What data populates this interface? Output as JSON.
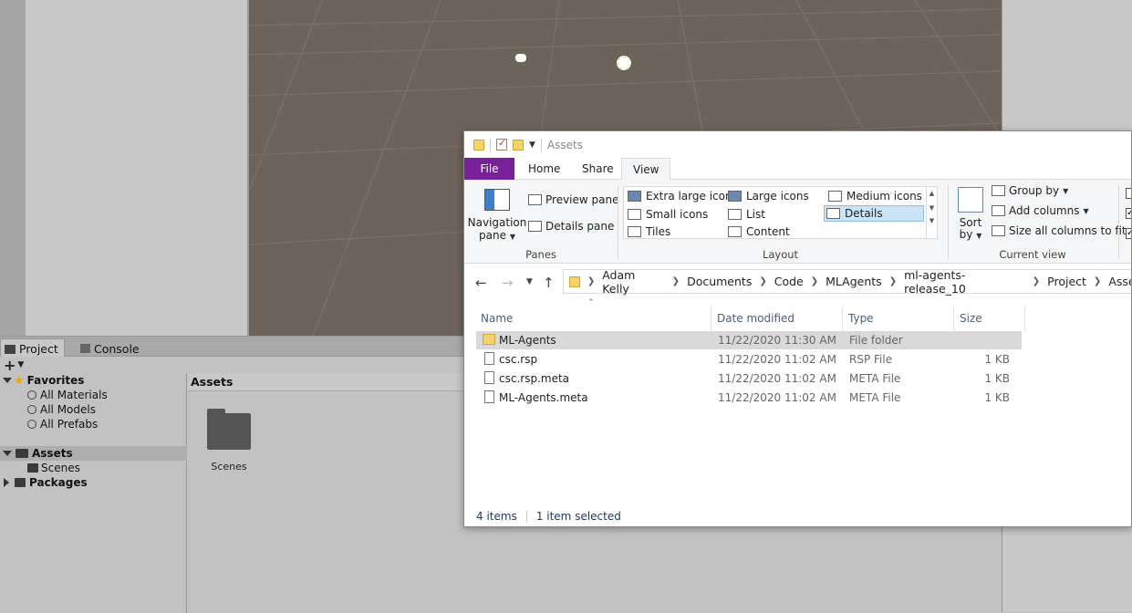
{
  "unity": {
    "tabs": {
      "project": "Project",
      "console": "Console"
    },
    "toolbar": {
      "add": "+"
    },
    "tree": {
      "favorites": "Favorites",
      "all_materials": "All Materials",
      "all_models": "All Models",
      "all_prefabs": "All Prefabs",
      "assets": "Assets",
      "scenes": "Scenes",
      "packages": "Packages"
    },
    "assets_header": "Assets",
    "folder_tile": "Scenes"
  },
  "explorer": {
    "title": "Assets",
    "tabs": {
      "file": "File",
      "home": "Home",
      "share": "Share",
      "view": "View"
    },
    "ribbon": {
      "navigation_pane": "Navigation",
      "navigation_pane_2": "pane",
      "preview_pane": "Preview pane",
      "details_pane": "Details pane",
      "panes_label": "Panes",
      "layout": {
        "extra_large_icons": "Extra large icons",
        "large_icons": "Large icons",
        "medium_icons": "Medium icons",
        "small_icons": "Small icons",
        "list": "List",
        "details": "Details",
        "tiles": "Tiles",
        "content": "Content"
      },
      "layout_label": "Layout",
      "sort_by": "Sort",
      "sort_by_2": "by",
      "group_by": "Group by",
      "add_columns": "Add columns",
      "size_all_columns": "Size all columns to fit",
      "current_view_label": "Current view"
    },
    "breadcrumb": [
      "Adam Kelly",
      "Documents",
      "Code",
      "MLAgents",
      "ml-agents-release_10",
      "Project",
      "Assets"
    ],
    "columns": {
      "name": "Name",
      "date": "Date modified",
      "type": "Type",
      "size": "Size"
    },
    "files": [
      {
        "name": "ML-Agents",
        "date": "11/22/2020 11:30 AM",
        "type": "File folder",
        "size": ""
      },
      {
        "name": "csc.rsp",
        "date": "11/22/2020 11:02 AM",
        "type": "RSP File",
        "size": "1 KB"
      },
      {
        "name": "csc.rsp.meta",
        "date": "11/22/2020 11:02 AM",
        "type": "META File",
        "size": "1 KB"
      },
      {
        "name": "ML-Agents.meta",
        "date": "11/22/2020 11:02 AM",
        "type": "META File",
        "size": "1 KB"
      }
    ],
    "status": {
      "items": "4 items",
      "selected": "1 item selected"
    }
  }
}
